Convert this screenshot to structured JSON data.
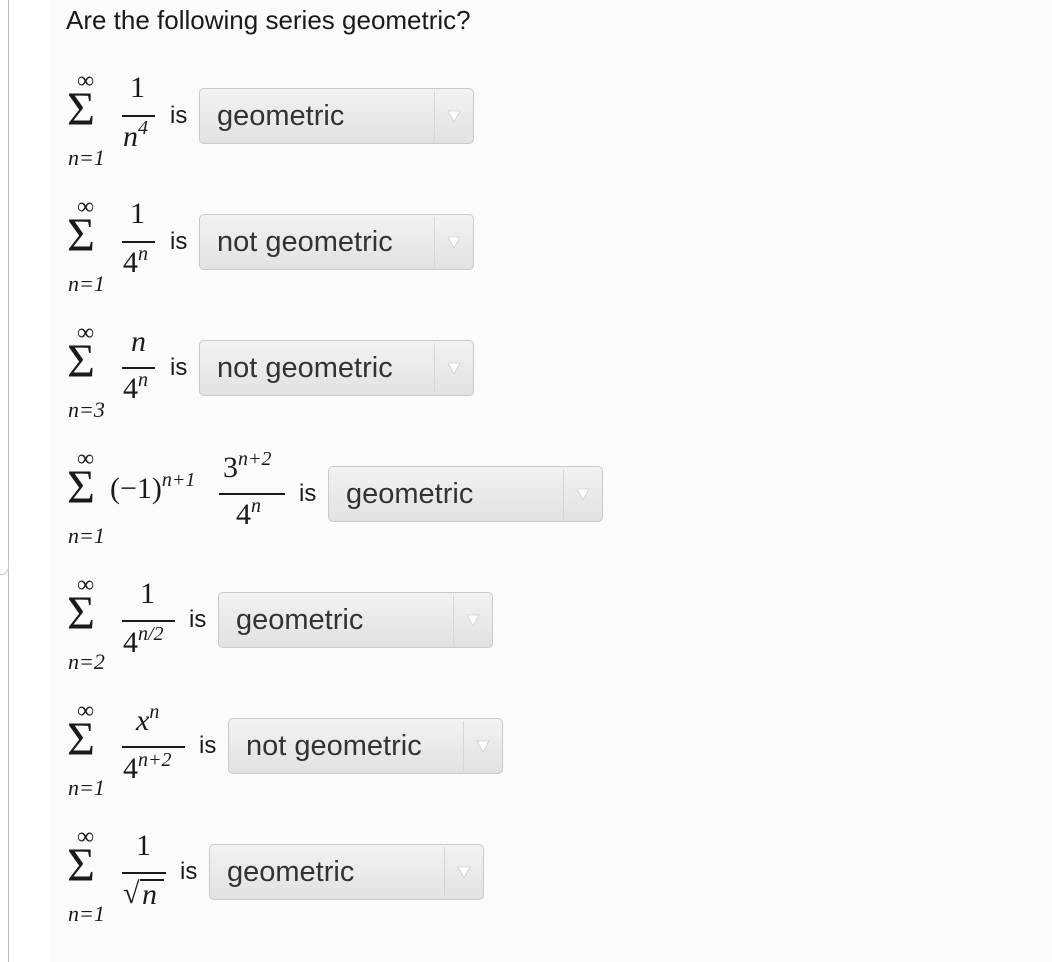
{
  "question": "Are the following series geometric?",
  "connector": "is",
  "rows": [
    {
      "sub": "n=1",
      "numerator": "1",
      "den_base": "n",
      "den_sup": "4",
      "answer": "geometric"
    },
    {
      "sub": "n=1",
      "numerator": "1",
      "den_base": "4",
      "den_sup": "n",
      "answer": "not geometric"
    },
    {
      "sub": "n=3",
      "numerator": "n",
      "den_base": "4",
      "den_sup": "n",
      "answer": "not geometric"
    },
    {
      "sub": "n=1",
      "prefix": "(−1)",
      "prefix_sup": "n+1",
      "num_base": "3",
      "num_sup": "n+2",
      "den_base": "4",
      "den_sup": "n",
      "answer": "geometric"
    },
    {
      "sub": "n=2",
      "numerator": "1",
      "den_base": "4",
      "den_sup": "n/2",
      "answer": "geometric"
    },
    {
      "sub": "n=1",
      "num_base": "x",
      "num_sup": "n",
      "den_base": "4",
      "den_sup": "n+2",
      "answer": "not geometric"
    },
    {
      "sub": "n=1",
      "numerator": "1",
      "den_sqrt": "n",
      "answer": "geometric"
    }
  ],
  "colors": {
    "select_bg": "#e8e8e8",
    "arrow": "#ffffff",
    "text": "#1a1a1a"
  },
  "icons": {
    "dropdown": "triangle-down-icon"
  }
}
